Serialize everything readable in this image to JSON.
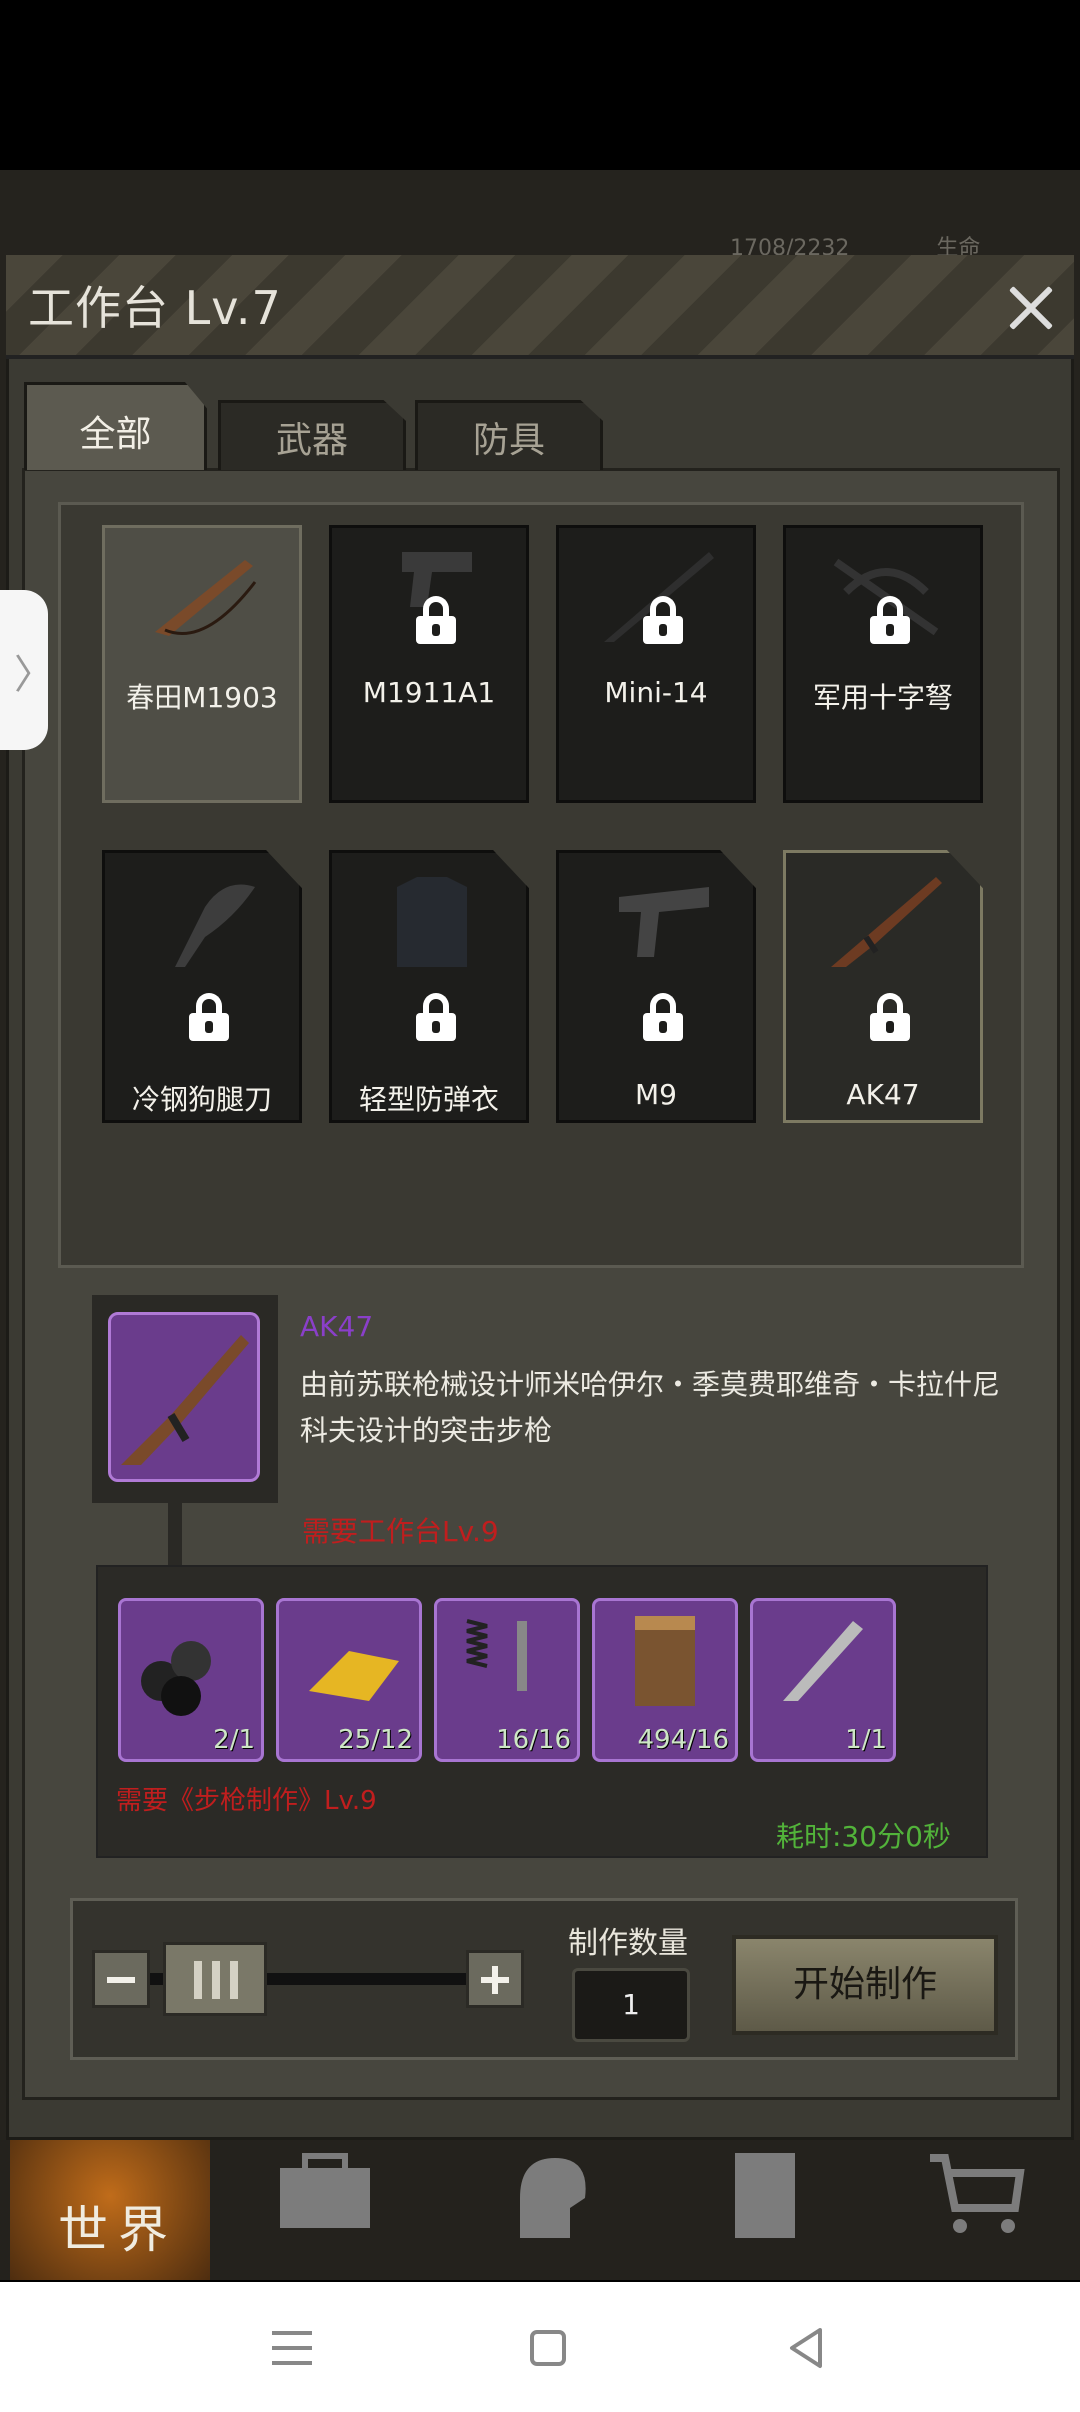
{
  "stats": {
    "hp": "1708/2232",
    "life_label": "生命"
  },
  "header": {
    "title": "工作台 Lv.7"
  },
  "tabs": [
    {
      "label": "全部"
    },
    {
      "label": "武器"
    },
    {
      "label": "防具"
    }
  ],
  "grid": {
    "items": [
      {
        "name": "春田M1903",
        "locked": false
      },
      {
        "name": "M1911A1",
        "locked": true
      },
      {
        "name": "Mini-14",
        "locked": true
      },
      {
        "name": "军用十字弩",
        "locked": true
      },
      {
        "name": "冷钢狗腿刀",
        "locked": true
      },
      {
        "name": "轻型防弹衣",
        "locked": true
      },
      {
        "name": "M9",
        "locked": true
      },
      {
        "name": "AK47",
        "locked": true,
        "selected": true
      }
    ]
  },
  "detail": {
    "name": "AK47",
    "description": "由前苏联枪械设计师米哈伊尔・季莫费耶维奇・卡拉什尼科夫设计的突击步枪",
    "requirement_workbench": "需要工作台Lv.9",
    "requirement_skill": "需要《步枪制作》Lv.9",
    "time_cost": "耗时:30分0秒",
    "materials": [
      {
        "icon": "pipes-icon",
        "count": "2/1"
      },
      {
        "icon": "gold-bar-icon",
        "count": "25/12"
      },
      {
        "icon": "spring-bolt-icon",
        "count": "16/16"
      },
      {
        "icon": "wood-block-icon",
        "count": "494/16"
      },
      {
        "icon": "gun-part-icon",
        "count": "1/1"
      }
    ]
  },
  "controls": {
    "quantity_label": "制作数量",
    "quantity": "1",
    "start_label": "开始制作"
  },
  "game_nav": {
    "world_label": "世界"
  },
  "colors": {
    "accent_purple": "#6a3c8c",
    "warning_red": "#c01e1e",
    "time_green": "#52b33a"
  }
}
